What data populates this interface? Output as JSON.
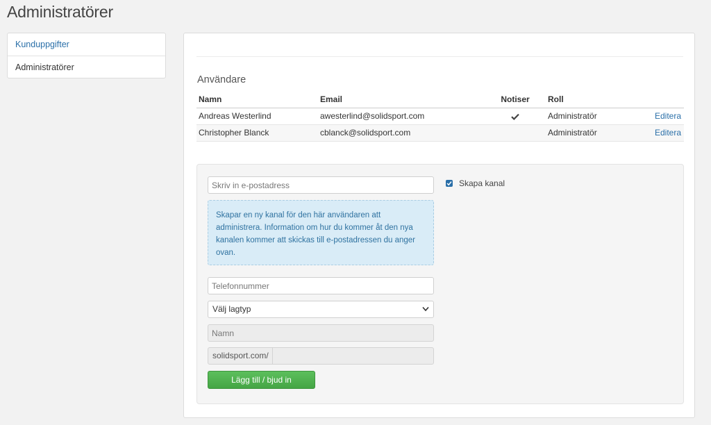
{
  "page": {
    "title": "Administratörer"
  },
  "sidebar": {
    "items": [
      {
        "label": "Kunduppgifter",
        "active": true
      },
      {
        "label": "Administratörer",
        "active": false
      }
    ]
  },
  "users": {
    "title": "Användare",
    "columns": {
      "name": "Namn",
      "email": "Email",
      "notis": "Notiser",
      "role": "Roll"
    },
    "rows": [
      {
        "name": "Andreas Westerlind",
        "email": "awesterlind@solidsport.com",
        "notis": true,
        "role": "Administratör",
        "edit": "Editera"
      },
      {
        "name": "Christopher Blanck",
        "email": "cblanck@solidsport.com",
        "notis": false,
        "role": "Administratör",
        "edit": "Editera"
      }
    ]
  },
  "form": {
    "email_placeholder": "Skriv in e-postadress",
    "info_text": "Skapar en ny kanal för den här användaren att administrera. Information om hur du kommer åt den nya kanalen kommer att skickas till e-postadressen du anger ovan.",
    "phone_placeholder": "Telefonnummer",
    "team_type_selected": "Välj lagtyp",
    "name_placeholder": "Namn",
    "url_prefix": "solidsport.com/",
    "submit_label": "Lägg till / bjud in",
    "create_channel_label": "Skapa kanal",
    "create_channel_checked": true
  },
  "colors": {
    "accent": "#2a6fa8",
    "success": "#4cae4c",
    "info_bg": "#d9ecf7"
  }
}
